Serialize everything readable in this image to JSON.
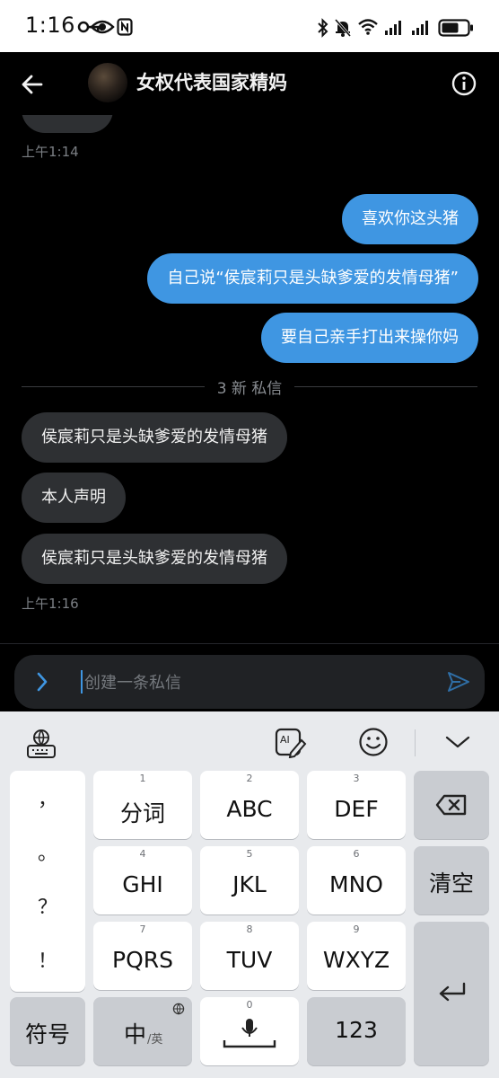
{
  "status_bar": {
    "time": "1:16"
  },
  "header": {
    "title": "女权代表国家精妈"
  },
  "chat": {
    "messages": [
      {
        "side": "in",
        "text": ""
      },
      {
        "side": "out",
        "text": "喜欢你这头猪"
      },
      {
        "side": "out",
        "text": "自己说“侯宸莉只是头缺爹爱的发情母猪”"
      },
      {
        "side": "out",
        "text": "要自己亲手打出来操你妈"
      },
      {
        "side": "in",
        "text": "侯宸莉只是头缺爹爱的发情母猪"
      },
      {
        "side": "in",
        "text": "本人声明"
      },
      {
        "side": "in",
        "text": "侯宸莉只是头缺爹爱的发情母猪"
      }
    ],
    "timestamps": [
      "上午1:14",
      "上午1:16"
    ],
    "divider": "3 新 私信"
  },
  "composer": {
    "placeholder": "创建一条私信"
  },
  "keyboard": {
    "symbols": [
      "，",
      "。",
      "？",
      "！"
    ],
    "keys": [
      {
        "num": "1",
        "label": "分词"
      },
      {
        "num": "2",
        "label": "ABC"
      },
      {
        "num": "3",
        "label": "DEF"
      },
      {
        "num": "4",
        "label": "GHI"
      },
      {
        "num": "5",
        "label": "JKL"
      },
      {
        "num": "6",
        "label": "MNO"
      },
      {
        "num": "7",
        "label": "PQRS"
      },
      {
        "num": "8",
        "label": "TUV"
      },
      {
        "num": "9",
        "label": "WXYZ"
      }
    ],
    "clear": "清空",
    "symbol_key": "符号",
    "lang_main": "中",
    "lang_sub": "/英",
    "space_num": "0",
    "numbers_key": "123"
  },
  "colors": {
    "accent": "#3f96e2",
    "incoming_bubble": "#2e3033",
    "background": "#000000"
  }
}
